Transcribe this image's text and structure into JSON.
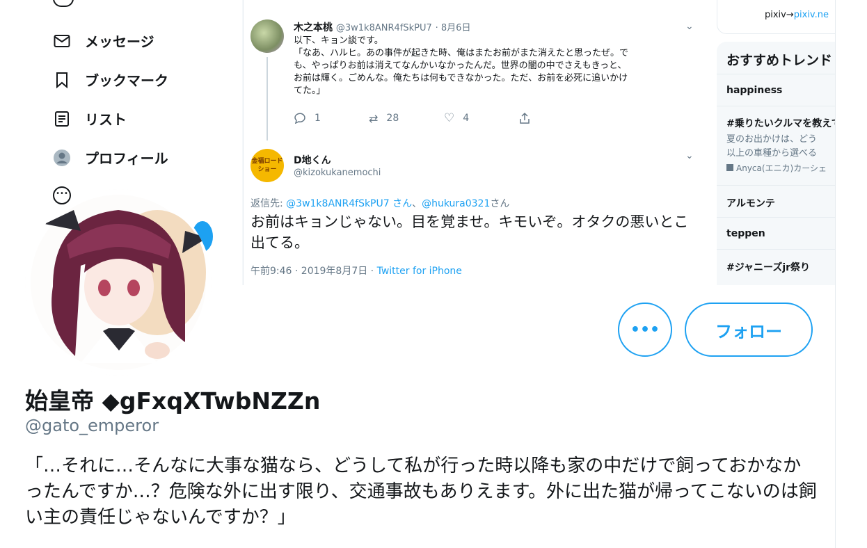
{
  "banner": {
    "nav": [
      {
        "label": "メッセージ",
        "icon": "mail-icon"
      },
      {
        "label": "ブックマーク",
        "icon": "bookmark-icon"
      },
      {
        "label": "リスト",
        "icon": "list-icon"
      },
      {
        "label": "プロフィール",
        "icon": "profile-icon"
      }
    ],
    "tweet": {
      "name": "木之本桃",
      "handle": "@3w1k8ANR4fSkPU7",
      "date": "· 8月6日",
      "lines": [
        "以下、キョン談です。",
        "「なあ、ハルヒ。あの事件が起きた時、俺はまたお前がまた消えたと思ったぜ。で",
        "も、やっぱりお前は消えてなんかいなかったんだ。世界の闇の中でさえもきっと、",
        "お前は輝く。ごめんな。俺たちは何もできなかった。ただ、お前を必死に追いかけ",
        "てた。」"
      ],
      "replies": "1",
      "retweets": "28",
      "likes": "4"
    },
    "reply": {
      "name": "D地くん",
      "handle": "@kizokukanemochi",
      "avatar_text": "金福ロードショー",
      "reply_prefix": "返信先: ",
      "reply_to_1": "@3w1k8ANR4fSkPU7 さん",
      "reply_sep": "、",
      "reply_to_2": "@hukura0321",
      "reply_suffix": "さん",
      "text": "お前はキョンじゃない。目を覚ませ。キモいぞ。オタクの悪いとこ出てる。",
      "time": "午前9:46 · 2019年8月7日 · ",
      "client": "Twitter for iPhone"
    },
    "pixiv": {
      "prefix": "pixiv→",
      "link": "pixiv.ne"
    },
    "trends": {
      "title": "おすすめトレンド",
      "items": [
        {
          "title": "happiness"
        },
        {
          "title": "#乗りたいクルマを教えて",
          "sub1": "夏のお出かけは、どう",
          "sub2": "以上の車種から選べる",
          "promo": "Anyca(エニカ)カーシェ"
        },
        {
          "title": "アルモンテ"
        },
        {
          "title": "teppen"
        },
        {
          "title": "#ジャニーズjr祭り"
        }
      ]
    }
  },
  "profile": {
    "more_label": "•••",
    "follow_label": "フォロー",
    "name": "始皇帝 ◆gFxqXTwbNZZn",
    "handle": "@gato_emperor",
    "bio": "「…それに…そんなに大事な猫なら、どうして私が行った時以降も家の中だけで飼っておかなかったんですか…？危険な外に出す限り、交通事故もありえます。外に出た猫が帰ってこないのは飼い主の責任じゃないんですか？」"
  },
  "colors": {
    "accent": "#1da1f2",
    "muted": "#657786",
    "text": "#14171a",
    "border": "#e6ecf0"
  }
}
